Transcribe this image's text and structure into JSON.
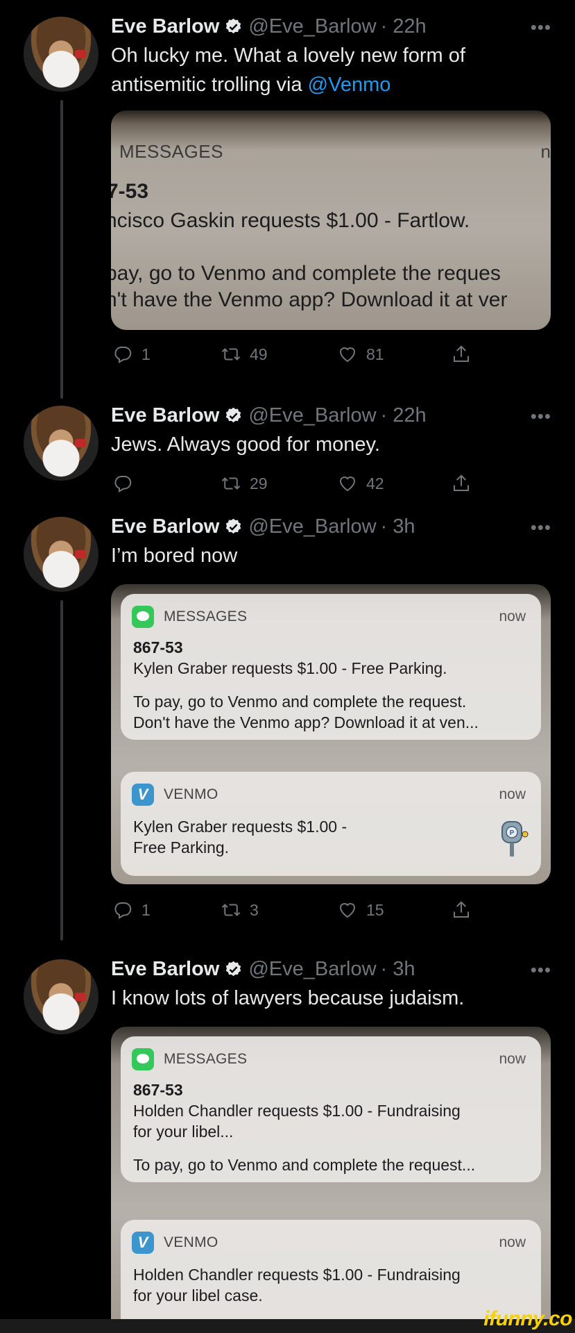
{
  "tweets": [
    {
      "name": "Eve Barlow",
      "handle": "@Eve_Barlow",
      "time": "· 22h",
      "more": "•••",
      "text_pre": "Oh lucky me. What a lovely new form of antisemitic trolling via ",
      "mention": "@Venmo",
      "media": {
        "app": "MESSAGES",
        "now_fragment": "n",
        "sender": "7-53",
        "line1": "ncisco Gaskin requests $1.00 - Fartlow.",
        "line2": "pay, go to Venmo and complete the reques",
        "line3": "n't have the Venmo app? Download it at ver"
      },
      "stats": {
        "replies": "1",
        "retweets": "49",
        "likes": "81"
      }
    },
    {
      "name": "Eve Barlow",
      "handle": "@Eve_Barlow",
      "time": "· 22h",
      "more": "•••",
      "text": "Jews. Always good for money.",
      "stats": {
        "replies": "",
        "retweets": "29",
        "likes": "42"
      }
    },
    {
      "name": "Eve Barlow",
      "handle": "@Eve_Barlow",
      "time": "· 3h",
      "more": "•••",
      "text": "I’m bored now",
      "notifications": [
        {
          "app": "MESSAGES",
          "now": "now",
          "sender": "867-53",
          "line1": "Kylen Graber requests $1.00 - Free Parking.",
          "line2": "To pay, go to Venmo and complete the request.",
          "line3": "Don't have the Venmo app? Download it at ven..."
        },
        {
          "app": "VENMO",
          "now": "now",
          "line1": "Kylen Graber requests $1.00 -",
          "line2": "Free Parking."
        }
      ],
      "stats": {
        "replies": "1",
        "retweets": "3",
        "likes": "15"
      }
    },
    {
      "name": "Eve Barlow",
      "handle": "@Eve_Barlow",
      "time": "· 3h",
      "more": "•••",
      "text": "I know lots of lawyers because judaism.",
      "notifications": [
        {
          "app": "MESSAGES",
          "now": "now",
          "sender": "867-53",
          "line1": "Holden Chandler requests $1.00 - Fundraising",
          "line2": "for your libel...",
          "line3": "To pay, go to Venmo and complete the request..."
        },
        {
          "app": "VENMO",
          "now": "now",
          "line1": "Holden Chandler requests $1.00 - Fundraising",
          "line2": "for your libel case."
        }
      ]
    }
  ],
  "watermark": "ifunny.co",
  "colors": {
    "background": "#000000",
    "link": "#1d9bf0",
    "muted": "#71767b",
    "verified": "#e7e9ea"
  }
}
